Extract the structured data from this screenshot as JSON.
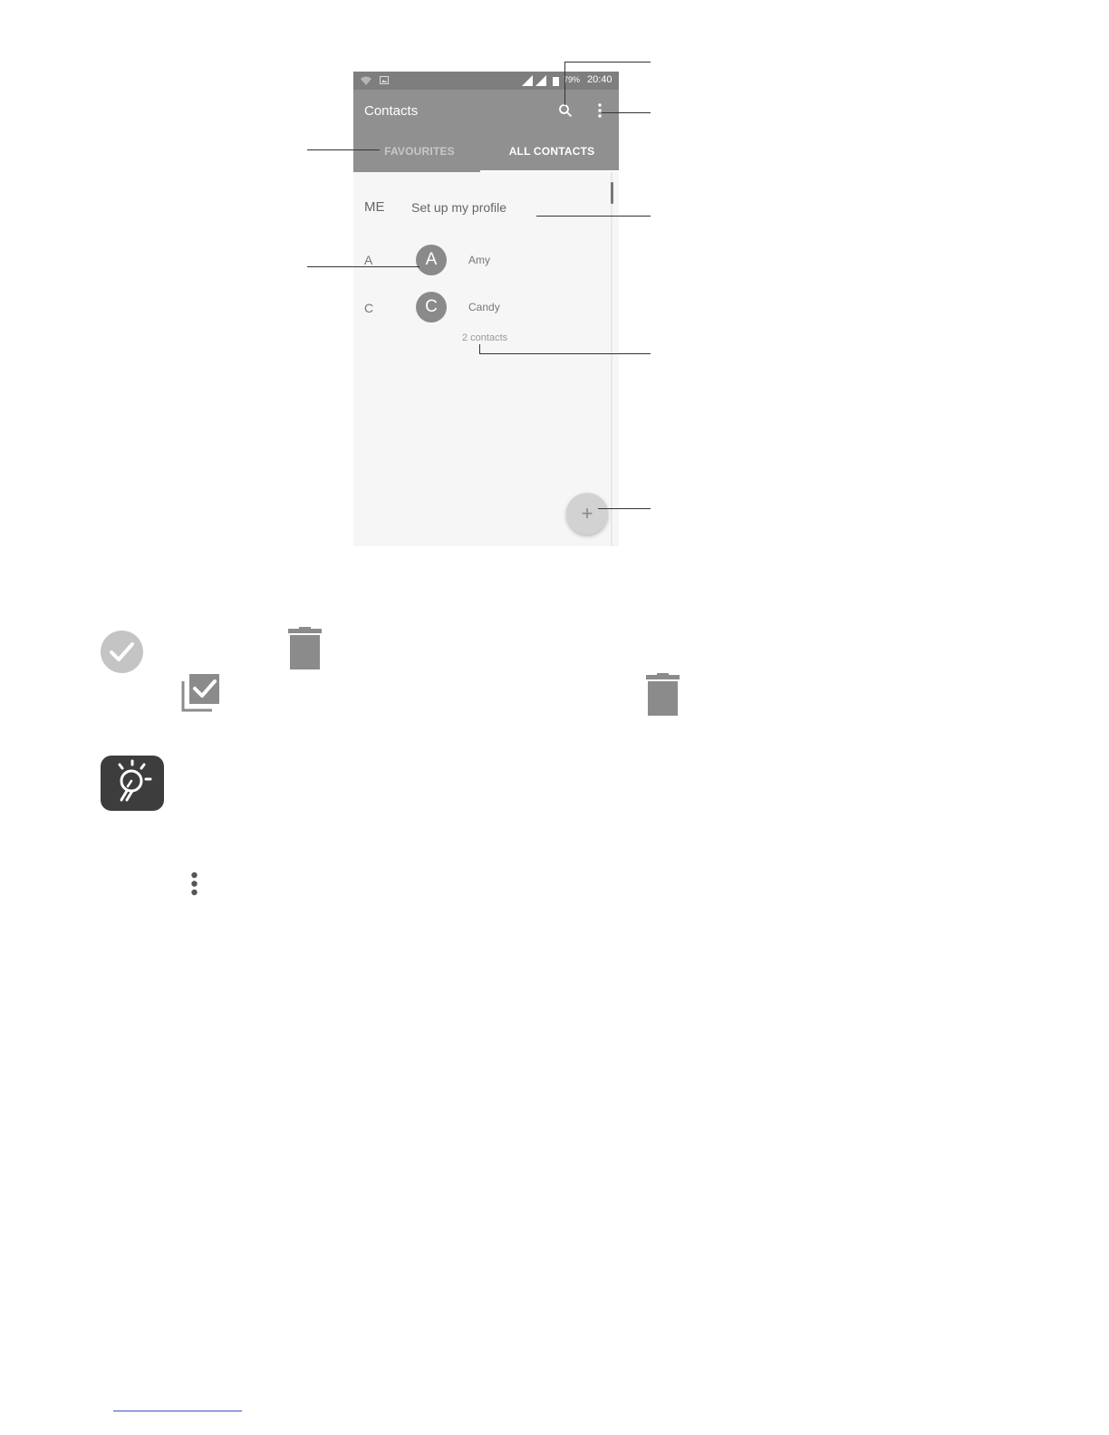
{
  "status_bar": {
    "battery": "79%",
    "time": "20:40"
  },
  "toolbar": {
    "title": "Contacts"
  },
  "tabs": [
    {
      "label": "FAVOURITES",
      "selected": false
    },
    {
      "label": "ALL CONTACTS",
      "selected": true
    }
  ],
  "profile": {
    "section": "ME",
    "label": "Set up my profile"
  },
  "contacts": [
    {
      "section": "A",
      "initial": "A",
      "name": "Amy"
    },
    {
      "section": "C",
      "initial": "C",
      "name": "Candy",
      "detail": "2 contacts"
    }
  ],
  "fab": {
    "symbol": "+"
  },
  "icons": {
    "select_circle": "check-circle-icon",
    "delete": "trash-icon",
    "select_all": "select-all-icon",
    "tip": "lightbulb-icon",
    "more": "more-vert-icon"
  },
  "colors": {
    "toolbar": "#909090",
    "status_bar": "#7e7e7e",
    "avatar": "#8a8a8a",
    "tip_badge": "#3d3d3d",
    "footnote_rule": "#3b4fc4"
  }
}
